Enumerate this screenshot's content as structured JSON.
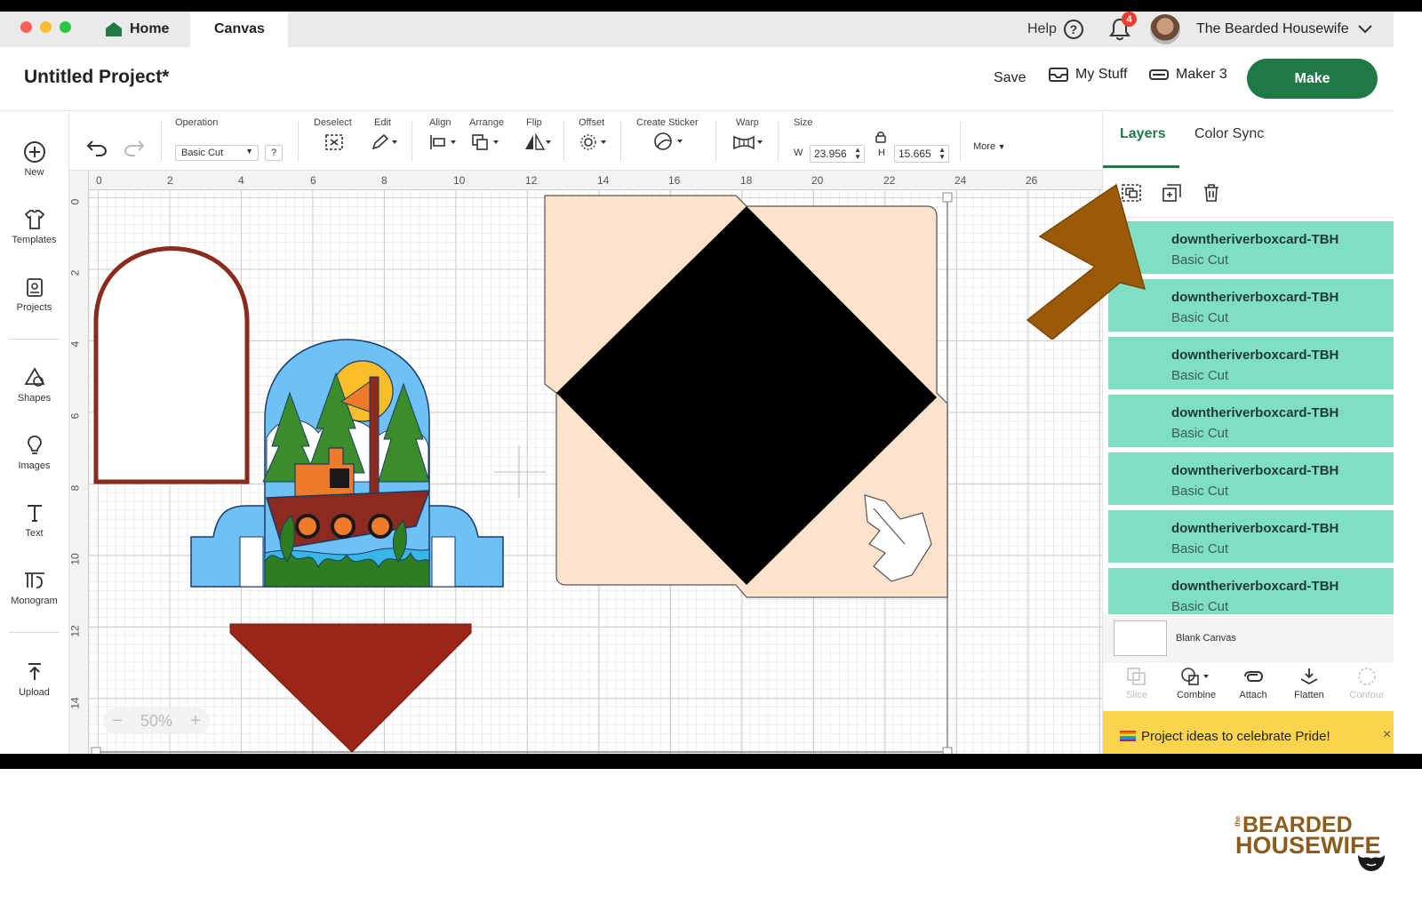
{
  "tabs": {
    "home": "Home",
    "canvas": "Canvas"
  },
  "topbar": {
    "help": "Help",
    "help_icon": "?",
    "notifications": "4",
    "username": "The Bearded Housewife"
  },
  "header": {
    "title": "Untitled Project*",
    "save": "Save",
    "my_stuff": "My Stuff",
    "machine": "Maker 3",
    "make": "Make"
  },
  "leftbar": {
    "items": [
      {
        "label": "New",
        "icon": "plus-circle-icon"
      },
      {
        "label": "Templates",
        "icon": "shirt-icon"
      },
      {
        "label": "Projects",
        "icon": "projects-icon"
      },
      {
        "label": "Shapes",
        "icon": "shapes-icon"
      },
      {
        "label": "Images",
        "icon": "lightbulb-icon"
      },
      {
        "label": "Text",
        "icon": "text-icon"
      },
      {
        "label": "Monogram",
        "icon": "monogram-icon"
      },
      {
        "label": "Upload",
        "icon": "upload-icon"
      }
    ]
  },
  "toolbar": {
    "operation_label": "Operation",
    "operation_value": "Basic Cut",
    "operation_help": "?",
    "deselect": "Deselect",
    "edit": "Edit",
    "align": "Align",
    "arrange": "Arrange",
    "flip": "Flip",
    "offset": "Offset",
    "create_sticker": "Create Sticker",
    "warp": "Warp",
    "size": "Size",
    "w_label": "W",
    "w_value": "23.956",
    "h_label": "H",
    "h_value": "15.665",
    "more": "More"
  },
  "rulers": {
    "top": [
      "0",
      "2",
      "4",
      "6",
      "8",
      "10",
      "12",
      "14",
      "16",
      "18",
      "20",
      "22",
      "24",
      "26"
    ],
    "left": [
      "0",
      "2",
      "4",
      "6",
      "8",
      "10",
      "12",
      "14"
    ]
  },
  "zoom": {
    "value": "50%",
    "minus": "−",
    "plus": "+"
  },
  "panel": {
    "tab_layers": "Layers",
    "tab_colorsync": "Color Sync",
    "layers": [
      {
        "name": "downtheriverboxcard-TBH",
        "op": "Basic Cut"
      },
      {
        "name": "downtheriverboxcard-TBH",
        "op": "Basic Cut"
      },
      {
        "name": "downtheriverboxcard-TBH",
        "op": "Basic Cut"
      },
      {
        "name": "downtheriverboxcard-TBH",
        "op": "Basic Cut"
      },
      {
        "name": "downtheriverboxcard-TBH",
        "op": "Basic Cut"
      },
      {
        "name": "downtheriverboxcard-TBH",
        "op": "Basic Cut"
      },
      {
        "name": "downtheriverboxcard-TBH",
        "op": "Basic Cut"
      }
    ],
    "blank_canvas": "Blank Canvas",
    "actions": {
      "slice": "Slice",
      "combine": "Combine",
      "attach": "Attach",
      "flatten": "Flatten",
      "contour": "Contour"
    },
    "promo": "Project ideas to celebrate Pride!",
    "promo_close": "×"
  },
  "brand": {
    "the": "the",
    "line1": "BEARDED",
    "line2": "HOUSEWIFE"
  },
  "colors": {
    "accent": "#1f7a46",
    "layer_bg": "#7fdfc3",
    "promo": "#fcd34d",
    "arrow": "#9a5a07"
  }
}
